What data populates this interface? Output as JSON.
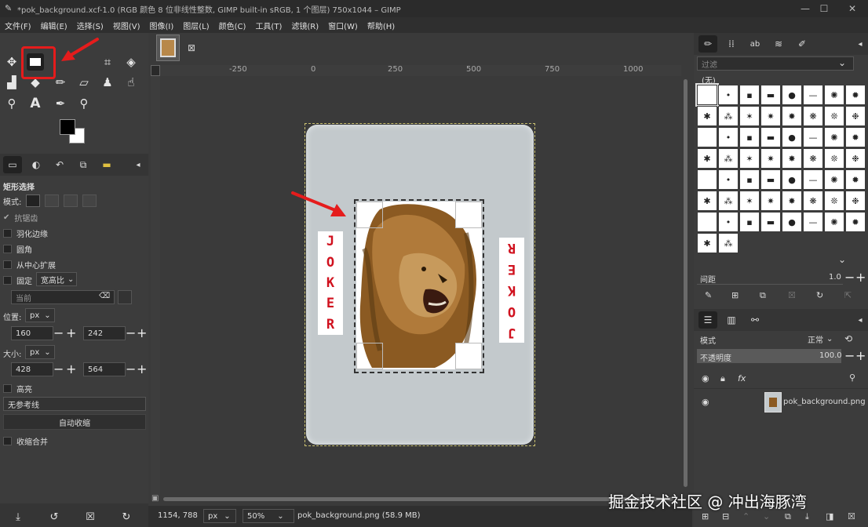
{
  "titlebar": {
    "title": "*pok_background.xcf-1.0 (RGB 颜色 8 位非线性整数, GIMP built-in sRGB, 1 个图层) 750x1044 – GIMP",
    "minimize": "—",
    "maximize": "☐",
    "close": "✕"
  },
  "menu": [
    "文件(F)",
    "编辑(E)",
    "选择(S)",
    "视图(V)",
    "图像(I)",
    "图层(L)",
    "颜色(C)",
    "工具(T)",
    "滤镜(R)",
    "窗口(W)",
    "帮助(H)"
  ],
  "tool_options": {
    "title": "矩形选择",
    "mode_label": "模式:",
    "antialias": "抗锯齿",
    "feather": "羽化边缘",
    "rounded": "圆角",
    "expand_center": "从中心扩展",
    "fixed_label": "固定",
    "fixed_value": "宽高比",
    "ratio_placeholder": "当前",
    "position_label": "位置:",
    "position_unit": "px",
    "pos_x": "160",
    "pos_y": "242",
    "size_label": "大小:",
    "size_unit": "px",
    "size_w": "428",
    "size_h": "564",
    "highlight": "高亮",
    "guides": "无参考线",
    "auto_shrink": "自动收缩",
    "shrink_merged": "收缩合并"
  },
  "canvas": {
    "ruler_marks": [
      "-250",
      "0",
      "250",
      "500",
      "750",
      "1000"
    ],
    "card_left_text": "JOKER",
    "card_right_text": "JOKER"
  },
  "status": {
    "coords": "1154, 788",
    "unit": "px",
    "zoom": "50%",
    "file_info": "pok_background.png (58.9 MB)"
  },
  "brushes": {
    "filter_placeholder": "过滤",
    "none_label": "(无)",
    "spacing_label": "间距",
    "spacing_value": "1.0"
  },
  "layers": {
    "mode_label": "模式",
    "mode_value": "正常",
    "opacity_label": "不透明度",
    "opacity_value": "100.0",
    "layer_name": "pok_background.png"
  },
  "watermark": "掘金技术社区 @ 冲出海豚湾",
  "colors": {
    "accent_red": "#e51c1c",
    "card_bg": "#c3c9cc",
    "joker_red": "#d0111e"
  }
}
